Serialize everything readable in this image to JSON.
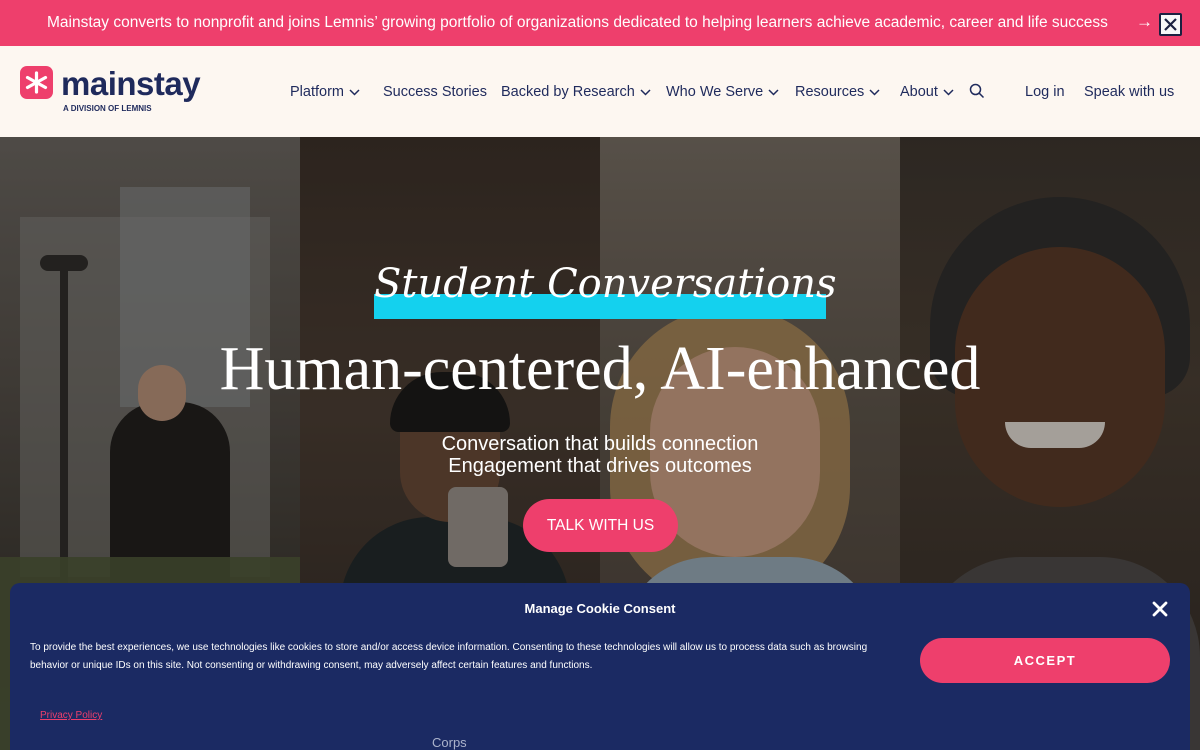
{
  "announcement": {
    "text": "Mainstay converts to nonprofit and joins Lemnis’ growing portfolio of organizations dedicated to helping learners achieve academic, career and life success",
    "arrow": "→"
  },
  "header": {
    "logo_word": "mainstay",
    "logo_sub": "A DIVISION OF LEMNIS",
    "nav": {
      "platform": "Platform",
      "success_stories": "Success Stories",
      "research": "Backed by Research",
      "who_we_serve": "Who We Serve",
      "resources": "Resources",
      "about": "About",
      "login": "Log in",
      "speak": "Speak with us"
    }
  },
  "hero": {
    "eyebrow": "Student Conversations",
    "title": "Human-centered, AI-enhanced",
    "subtitle_1": "Conversation that builds connection",
    "subtitle_2": "Engagement that drives outcomes",
    "cta": "TALK WITH US"
  },
  "cookie": {
    "title": "Manage Cookie Consent",
    "body": "To provide the best experiences, we use technologies like cookies to store and/or access device information. Consenting to these technologies will allow us to process data such as browsing behavior or unique IDs on this site. Not consenting or withdrawing consent, may adversely affect certain features and functions.",
    "accept": "ACCEPT",
    "privacy": "Privacy Policy",
    "peek_text": "Corps"
  },
  "colors": {
    "brand_pink": "#ee3f6c",
    "navy": "#1f2a5c",
    "cookie_bg": "#1b2a63",
    "highlight_cyan": "#14d1ee",
    "header_bg": "#fdf7f1"
  },
  "icons": {
    "announce_close": "close-icon",
    "search": "search-icon",
    "chevron": "chevron-down-icon",
    "logo": "asterisk-logo-icon",
    "cookie_close": "close-icon"
  }
}
